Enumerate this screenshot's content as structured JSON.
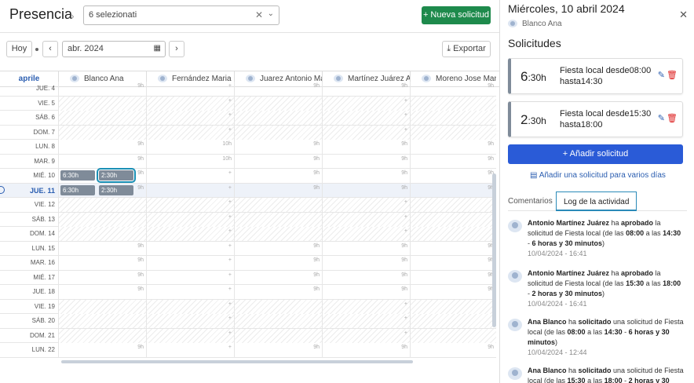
{
  "header": {
    "title": "Presencia",
    "selector_value": "6 selezionati",
    "new_request_label": "+ Nueva solicitud"
  },
  "toolbar": {
    "today_label": "Hoy",
    "date_value": "abr. 2024",
    "export_label": "Exportar"
  },
  "grid": {
    "month_label": "aprile",
    "employees": [
      "Blanco Ana",
      "Fernández Maria Lu",
      "Juarez Antonio Mar",
      "Martínez Juárez Ant",
      "Moreno Jose Marí"
    ],
    "rows": [
      {
        "label": "JUE. 4",
        "weekend": false
      },
      {
        "label": "VIE. 5",
        "weekend": true
      },
      {
        "label": "SÁB. 6",
        "weekend": true
      },
      {
        "label": "DOM. 7",
        "weekend": true
      },
      {
        "label": "LUN. 8",
        "weekend": false
      },
      {
        "label": "MAR. 9",
        "weekend": false
      },
      {
        "label": "MIÉ. 10",
        "weekend": false
      },
      {
        "label": "JUE. 11",
        "weekend": false,
        "today": true
      },
      {
        "label": "VIE. 12",
        "weekend": true
      },
      {
        "label": "SÁB. 13",
        "weekend": true
      },
      {
        "label": "DOM. 14",
        "weekend": true
      },
      {
        "label": "LUN. 15",
        "weekend": false
      },
      {
        "label": "MAR. 16",
        "weekend": false
      },
      {
        "label": "MIÉ. 17",
        "weekend": false
      },
      {
        "label": "JUE. 18",
        "weekend": false
      },
      {
        "label": "VIE. 19",
        "weekend": true
      },
      {
        "label": "SÁB. 20",
        "weekend": true
      },
      {
        "label": "DOM. 21",
        "weekend": true
      },
      {
        "label": "LUN. 22",
        "weekend": false
      }
    ],
    "chip_a": "6:30h",
    "chip_b": "2:30h",
    "hours_9": "9h",
    "hours_10": "10h",
    "plus": "+"
  },
  "panel": {
    "date_title": "Miércoles, 10 abril 2024",
    "user": "Blanco Ana",
    "section_title": "Solicitudes",
    "requests": [
      {
        "hours": "6",
        "minutes": ":30h",
        "text": "Fiesta local desde08:00 hasta14:30"
      },
      {
        "hours": "2",
        "minutes": ":30h",
        "text": "Fiesta local desde15:30 hasta18:00"
      }
    ],
    "add_label": "+ Añadir solicitud",
    "multi_label": "Añadir una solicitud para varios días",
    "tab_comments": "Comentarios",
    "tab_log": "Log de la actividad",
    "log": [
      {
        "html": "<b>Antonio Martínez Juárez</b> ha <b>aprobado</b> la solicitud de Fiesta local (de las <b>08:00</b> a las <b>14:30</b> - <b>6 horas y 30 minutos</b>)",
        "ts": "10/04/2024 - 16:41"
      },
      {
        "html": "<b>Antonio Martínez Juárez</b> ha <b>aprobado</b> la solicitud de Fiesta local (de las <b>15:30</b> a las <b>18:00</b> - <b>2 horas y 30 minutos</b>)",
        "ts": "10/04/2024 - 16:41"
      },
      {
        "html": "<b>Ana Blanco</b> ha <b>solicitado</b> una solicitud de Fiesta local (de las <b>08:00</b> a las <b>14:30</b> - <b>6 horas y 30 minutos</b>)",
        "ts": "10/04/2024 - 12:44"
      },
      {
        "html": "<b>Ana Blanco</b> ha <b>solicitado</b> una solicitud de Fiesta local (de las <b>15:30</b> a las <b>18:00</b> - <b>2 horas y 30</b>",
        "ts": ""
      }
    ]
  }
}
